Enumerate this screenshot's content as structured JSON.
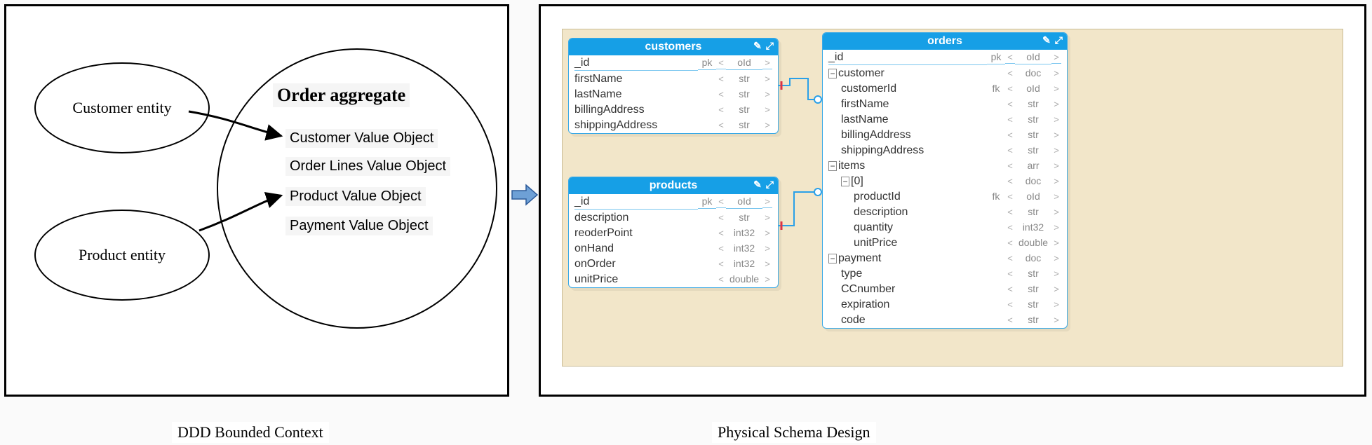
{
  "captions": {
    "left": "DDD Bounded Context",
    "right": "Physical Schema Design"
  },
  "ddd": {
    "customer_entity": "Customer entity",
    "product_entity": "Product entity",
    "aggregate_title": "Order aggregate",
    "value_objects": {
      "customer": "Customer Value Object",
      "order_lines": "Order Lines Value Object",
      "product": "Product Value Object",
      "payment": "Payment Value Object"
    }
  },
  "schema": {
    "customers": {
      "title": "customers",
      "rows": [
        {
          "name": "_id",
          "key": "pk",
          "type": "oId"
        },
        {
          "name": "firstName",
          "key": "",
          "type": "str"
        },
        {
          "name": "lastName",
          "key": "",
          "type": "str"
        },
        {
          "name": "billingAddress",
          "key": "",
          "type": "str"
        },
        {
          "name": "shippingAddress",
          "key": "",
          "type": "str"
        }
      ]
    },
    "products": {
      "title": "products",
      "rows": [
        {
          "name": "_id",
          "key": "pk",
          "type": "oId"
        },
        {
          "name": "description",
          "key": "",
          "type": "str"
        },
        {
          "name": "reoderPoint",
          "key": "",
          "type": "int32"
        },
        {
          "name": "onHand",
          "key": "",
          "type": "int32"
        },
        {
          "name": "onOrder",
          "key": "",
          "type": "int32"
        },
        {
          "name": "unitPrice",
          "key": "",
          "type": "double"
        }
      ]
    },
    "orders": {
      "title": "orders",
      "rows": [
        {
          "indent": 0,
          "toggle": "",
          "name": "_id",
          "key": "pk",
          "type": "oId"
        },
        {
          "indent": 0,
          "toggle": "−",
          "name": "customer",
          "key": "",
          "type": "doc"
        },
        {
          "indent": 1,
          "toggle": "",
          "name": "customerId",
          "key": "fk",
          "type": "oId"
        },
        {
          "indent": 1,
          "toggle": "",
          "name": "firstName",
          "key": "",
          "type": "str"
        },
        {
          "indent": 1,
          "toggle": "",
          "name": "lastName",
          "key": "",
          "type": "str"
        },
        {
          "indent": 1,
          "toggle": "",
          "name": "billingAddress",
          "key": "",
          "type": "str"
        },
        {
          "indent": 1,
          "toggle": "",
          "name": "shippingAddress",
          "key": "",
          "type": "str"
        },
        {
          "indent": 0,
          "toggle": "−",
          "name": "items",
          "key": "",
          "type": "arr"
        },
        {
          "indent": 1,
          "toggle": "−",
          "name": "[0]",
          "key": "",
          "type": "doc"
        },
        {
          "indent": 2,
          "toggle": "",
          "name": "productId",
          "key": "fk",
          "type": "oId"
        },
        {
          "indent": 2,
          "toggle": "",
          "name": "description",
          "key": "",
          "type": "str"
        },
        {
          "indent": 2,
          "toggle": "",
          "name": "quantity",
          "key": "",
          "type": "int32"
        },
        {
          "indent": 2,
          "toggle": "",
          "name": "unitPrice",
          "key": "",
          "type": "double"
        },
        {
          "indent": 0,
          "toggle": "−",
          "name": "payment",
          "key": "",
          "type": "doc"
        },
        {
          "indent": 1,
          "toggle": "",
          "name": "type",
          "key": "",
          "type": "str"
        },
        {
          "indent": 1,
          "toggle": "",
          "name": "CCnumber",
          "key": "",
          "type": "str"
        },
        {
          "indent": 1,
          "toggle": "",
          "name": "expiration",
          "key": "",
          "type": "str"
        },
        {
          "indent": 1,
          "toggle": "",
          "name": "code",
          "key": "",
          "type": "str"
        }
      ]
    }
  },
  "glyphs": {
    "lt": "<",
    "gt": ">"
  }
}
